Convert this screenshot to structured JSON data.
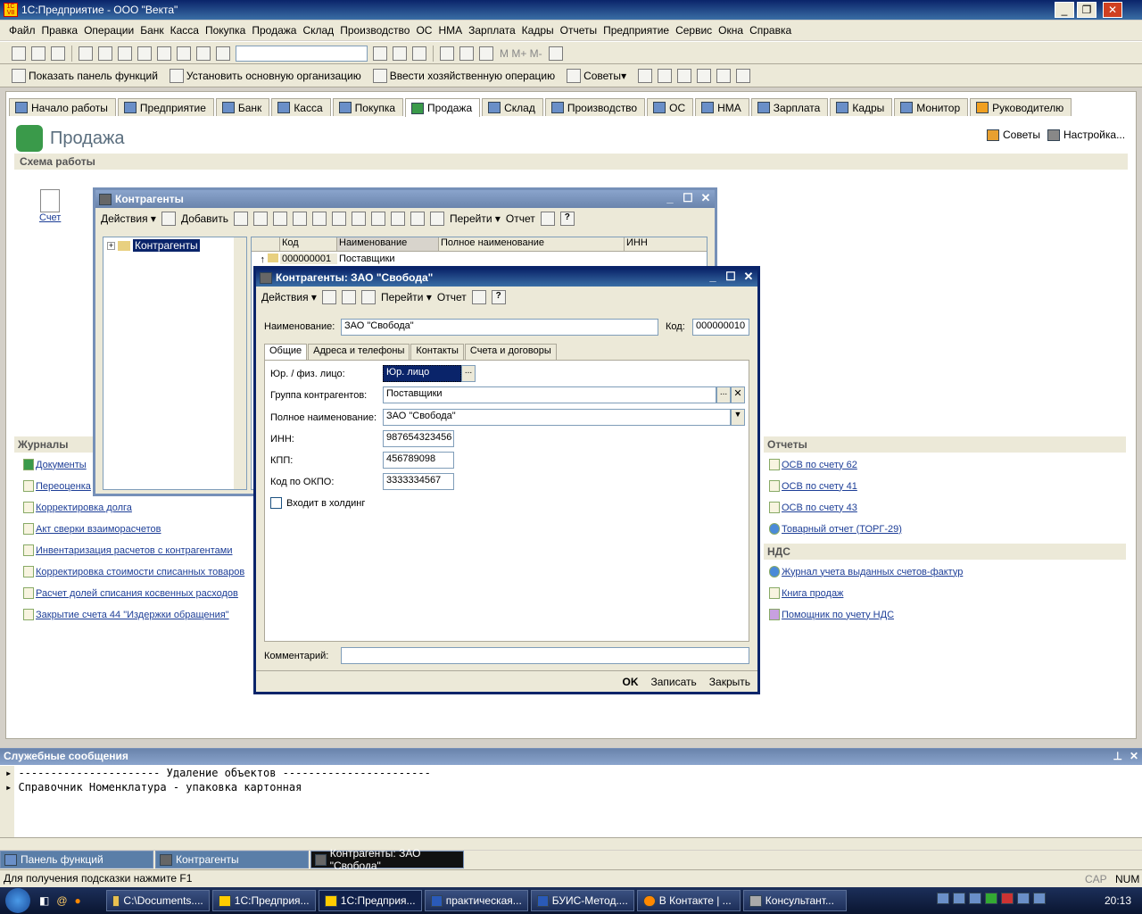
{
  "app_title": "1С:Предприятие - ООО \"Векта\"",
  "menu": [
    "Файл",
    "Правка",
    "Операции",
    "Банк",
    "Касса",
    "Покупка",
    "Продажа",
    "Склад",
    "Производство",
    "ОС",
    "НМА",
    "Зарплата",
    "Кадры",
    "Отчеты",
    "Предприятие",
    "Сервис",
    "Окна",
    "Справка"
  ],
  "toolbar2": {
    "show_panel": "Показать панель функций",
    "set_org": "Установить основную организацию",
    "enter_op": "Ввести хозяйственную операцию",
    "tips": "Советы"
  },
  "tabs": [
    "Начало работы",
    "Предприятие",
    "Банк",
    "Касса",
    "Покупка",
    "Продажа",
    "Склад",
    "Производство",
    "ОС",
    "НМА",
    "Зарплата",
    "Кадры",
    "Монитор",
    "Руководителю"
  ],
  "page": {
    "title": "Продажа",
    "tips": "Советы",
    "settings": "Настройка...",
    "scheme": "Схема работы",
    "schet": "Счет",
    "journals": "Журналы",
    "reports": "Отчеты",
    "nds": "НДС"
  },
  "journals": [
    "Документы",
    "Переоценка",
    "Корректировка долга",
    "Акт сверки взаиморасчетов",
    "Инвентаризация расчетов с контрагентами",
    "Корректировка стоимости списанных товаров",
    "Расчет долей списания косвенных расходов",
    "Закрытие счета 44 \"Издержки обращения\""
  ],
  "reports": [
    "ОСВ по счету 62",
    "ОСВ по счету 41",
    "ОСВ по счету 43",
    "Товарный отчет (ТОРГ-29)"
  ],
  "nds": [
    "Журнал учета выданных счетов-фактур",
    "Книга продаж",
    "Помощник по учету НДС"
  ],
  "kontr": {
    "title": "Контрагенты",
    "actions": "Действия",
    "add": "Добавить",
    "goto": "Перейти",
    "report": "Отчет",
    "tree_root": "Контрагенты",
    "cols": [
      "Код",
      "Наименование",
      "Полное наименование",
      "ИНН"
    ],
    "row_code": "000000001",
    "row_name": "Поставщики"
  },
  "form": {
    "title": "Контрагенты: ЗАО \"Свобода\"",
    "actions": "Действия",
    "goto": "Перейти",
    "report": "Отчет",
    "name_label": "Наименование:",
    "name": "ЗАО \"Свобода\"",
    "code_label": "Код:",
    "code": "000000010",
    "subtabs": [
      "Общие",
      "Адреса и телефоны",
      "Контакты",
      "Счета и договоры"
    ],
    "type_label": "Юр. / физ. лицо:",
    "type": "Юр. лицо",
    "group_label": "Группа контрагентов:",
    "group": "Поставщики",
    "fullname_label": "Полное наименование:",
    "fullname": "ЗАО \"Свобода\"",
    "inn_label": "ИНН:",
    "inn": "987654323456",
    "kpp_label": "КПП:",
    "kpp": "456789098",
    "okpo_label": "Код по ОКПО:",
    "okpo": "3333334567",
    "holding": "Входит в холдинг",
    "comment_label": "Комментарий:",
    "ok": "OK",
    "save": "Записать",
    "close": "Закрыть"
  },
  "sys": {
    "title": "Служебные сообщения",
    "line1": "---------------------- Удаление объектов -----------------------",
    "line2": "Справочник Номенклатура - упаковка картонная"
  },
  "windowbar": [
    "Панель функций",
    "Контрагенты",
    "Контрагенты: ЗАО \"Свобода\""
  ],
  "status": {
    "hint": "Для получения подсказки нажмите F1",
    "cap": "CAP",
    "num": "NUM"
  },
  "taskbar": [
    "C:\\Documents....",
    "1С:Предприя...",
    "1С:Предприя...",
    "практическая...",
    "БУИС-Метод....",
    "В Контакте | ...",
    "Консультант..."
  ],
  "clock": "20:13"
}
